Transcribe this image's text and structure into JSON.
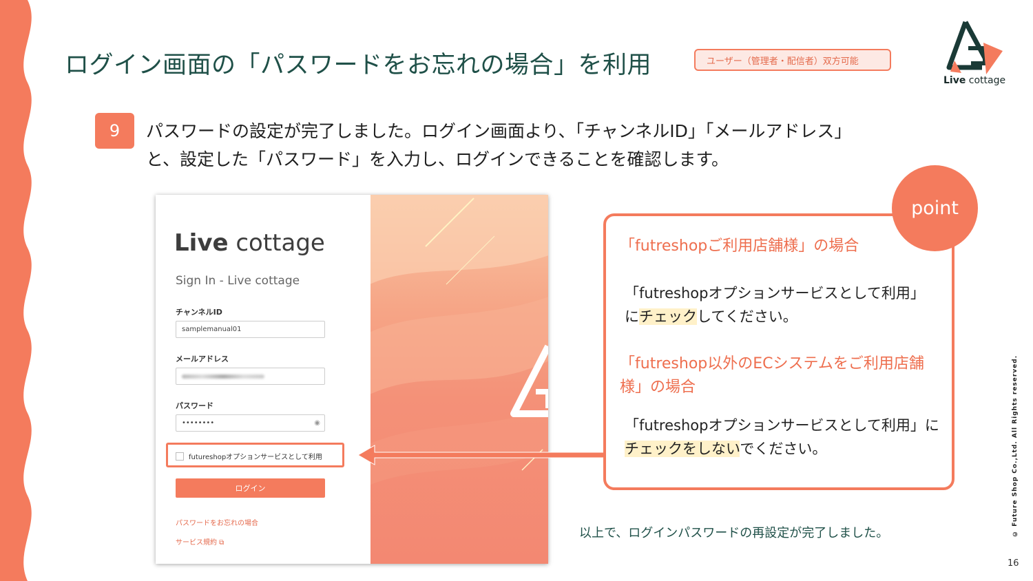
{
  "slide": {
    "title": "ログイン画面の「パスワードをお忘れの場合」を利用",
    "tag": "ユーザー（管理者・配信者）双方可能",
    "logo_text_bold": "Live",
    "logo_text_rest": " cottage",
    "step_number": "9",
    "step_line1": "パスワードの設定が完了しました。ログイン画面より、「チャンネルID」「メールアドレス」",
    "step_line2": "と、設定した「パスワード」を入力し、ログインできることを確認します。",
    "conclusion": "以上で、ログインパスワードの再設定が完了しました。",
    "copyright": "© Future Shop Co.,Ltd. All Rights reserved.",
    "page_number": "16"
  },
  "login": {
    "brand_bold": "Live",
    "brand_rest": " cottage",
    "signin_title": "Sign In - Live cottage",
    "channel_label": "チャンネルID",
    "channel_value": "samplemanual01",
    "email_label": "メールアドレス",
    "password_label": "パスワード",
    "password_value": "••••••••",
    "option_checkbox_label": "futureshopオプションサービスとして利用",
    "option_checked": false,
    "login_button": "ログイン",
    "forgot_link": "パスワードをお忘れの場合",
    "terms_link": "サービス規約 ⧉"
  },
  "point": {
    "badge": "point",
    "heading1": "「futreshopご利用店舗様」の場合",
    "body1_line1": "「futreshopオプションサービスとして利用」",
    "body1_line2_pre": "に",
    "body1_line2_mark": "チェック",
    "body1_line2_post": "してください。",
    "heading2_line1": "「futreshop以外のECシステムをご利用店舗",
    "heading2_line2": "様」の場合",
    "body2_line1": "「futreshopオプションサービスとして利用」に",
    "body2_line2_mark": "チェックをしない",
    "body2_line2_post": "でください。"
  },
  "colors": {
    "accent": "#f47b5d",
    "title": "#1f5048",
    "highlight": "#fff1c9"
  }
}
